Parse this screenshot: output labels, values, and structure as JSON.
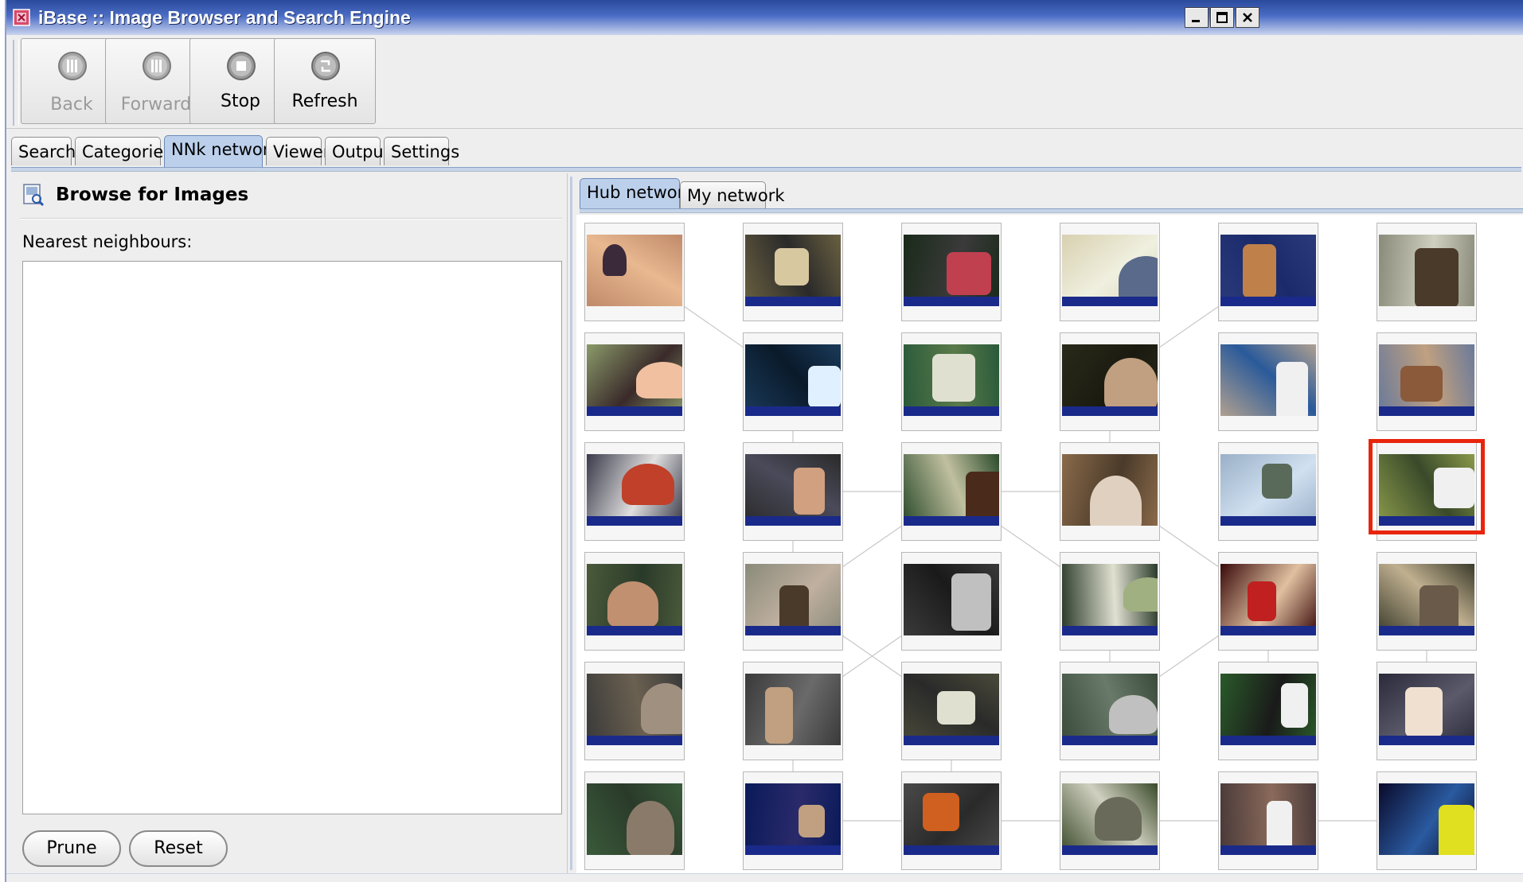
{
  "window": {
    "title": "iBase :: Image Browser and Search Engine"
  },
  "toolbar": {
    "buttons": [
      {
        "label": "Back",
        "icon": "back-icon",
        "enabled": false
      },
      {
        "label": "Forward",
        "icon": "forward-icon",
        "enabled": false
      },
      {
        "label": "Stop",
        "icon": "stop-icon",
        "enabled": true
      },
      {
        "label": "Refresh",
        "icon": "refresh-icon",
        "enabled": true
      }
    ]
  },
  "tabs": [
    {
      "label": "Search",
      "active": false
    },
    {
      "label": "Categories",
      "active": false
    },
    {
      "label": "NNk network",
      "active": true
    },
    {
      "label": "Viewer",
      "active": false
    },
    {
      "label": "Output",
      "active": false
    },
    {
      "label": "Settings",
      "active": false
    }
  ],
  "left_panel": {
    "title": "Browse for Images",
    "nearest_label": "Nearest neighbours:",
    "prune_label": "Prune",
    "reset_label": "Reset"
  },
  "right_panel": {
    "subtabs": [
      {
        "label": "Hub network",
        "active": true
      },
      {
        "label": "My network",
        "active": false
      }
    ],
    "grid": {
      "rows": 6,
      "cols": 6,
      "highlighted": {
        "row": 2,
        "col": 5
      },
      "highlight_color": "#e8250c"
    }
  },
  "colors": {
    "titlebar": "#2a4a9c",
    "tab_active": "#bcd0ec",
    "news_band": "#1a2a8a"
  }
}
